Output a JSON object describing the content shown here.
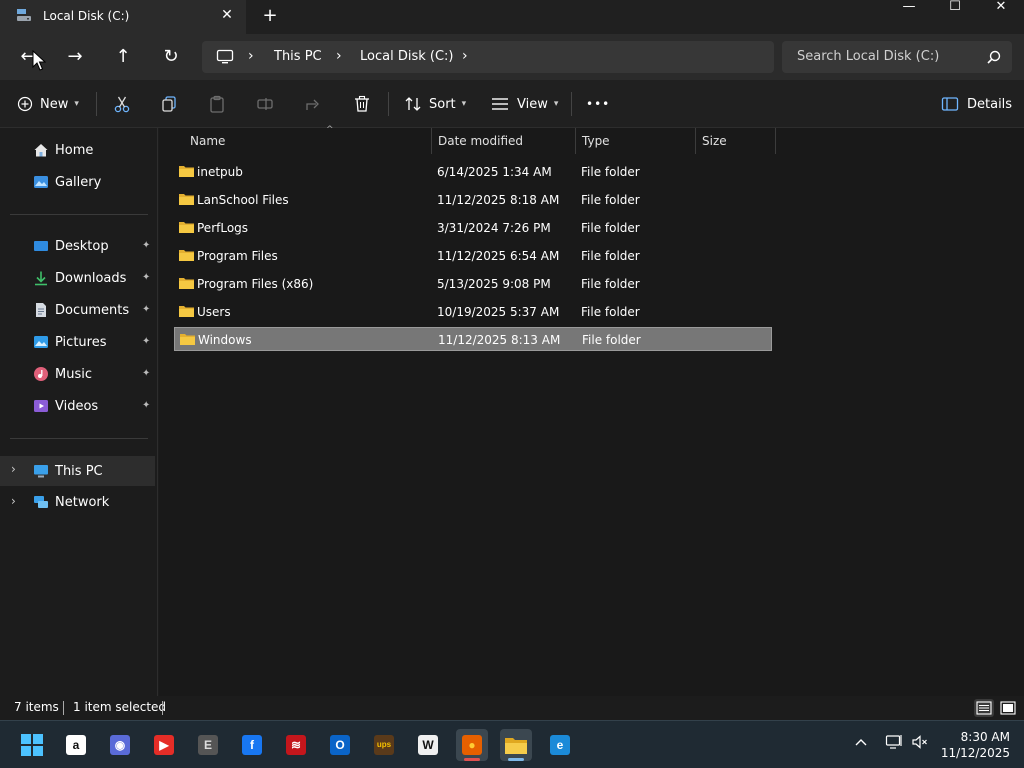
{
  "window": {
    "tab_title": "Local Disk (C:)",
    "tab_close": "✕",
    "new_tab": "+",
    "minimize": "—",
    "maximize": "☐",
    "close": "✕"
  },
  "address": {
    "crumbs": [
      "This PC",
      "Local Disk (C:)"
    ],
    "separator": "›",
    "search_placeholder": "Search Local Disk (C:)"
  },
  "nav_buttons": {
    "back": "←",
    "forward": "→",
    "up": "↑",
    "refresh": "↻"
  },
  "commandbar": {
    "new_label": "New",
    "sort_label": "Sort",
    "view_label": "View",
    "more": "•••",
    "details_label": "Details"
  },
  "navpane": {
    "items": [
      {
        "label": "Home",
        "icon": "home-icon"
      },
      {
        "label": "Gallery",
        "icon": "gallery-icon"
      },
      {
        "label": "Desktop",
        "icon": "desktop-icon",
        "pinned": true
      },
      {
        "label": "Downloads",
        "icon": "downloads-icon",
        "pinned": true
      },
      {
        "label": "Documents",
        "icon": "documents-icon",
        "pinned": true
      },
      {
        "label": "Pictures",
        "icon": "pictures-icon",
        "pinned": true
      },
      {
        "label": "Music",
        "icon": "music-icon",
        "pinned": true
      },
      {
        "label": "Videos",
        "icon": "videos-icon",
        "pinned": true
      },
      {
        "label": "This PC",
        "icon": "computer-icon",
        "expandable": true,
        "selected": true
      },
      {
        "label": "Network",
        "icon": "network-icon",
        "expandable": true
      }
    ],
    "pin_glyph": "📌",
    "chevron": "›"
  },
  "columns": {
    "name": "Name",
    "date": "Date modified",
    "type": "Type",
    "size": "Size"
  },
  "files": [
    {
      "name": "inetpub",
      "date": "6/14/2025 1:34 AM",
      "type": "File folder"
    },
    {
      "name": "LanSchool Files",
      "date": "11/12/2025 8:18 AM",
      "type": "File folder"
    },
    {
      "name": "PerfLogs",
      "date": "3/31/2024 7:26 PM",
      "type": "File folder"
    },
    {
      "name": "Program Files",
      "date": "11/12/2025 6:54 AM",
      "type": "File folder"
    },
    {
      "name": "Program Files (x86)",
      "date": "5/13/2025 9:08 PM",
      "type": "File folder"
    },
    {
      "name": "Users",
      "date": "10/19/2025 5:37 AM",
      "type": "File folder"
    },
    {
      "name": "Windows",
      "date": "11/12/2025 8:13 AM",
      "type": "File folder",
      "selected": true
    }
  ],
  "status": {
    "count": "7 items",
    "selection": "1 item selected"
  },
  "taskbar": {
    "apps": [
      {
        "name": "start",
        "icon": "windows-start-icon"
      },
      {
        "name": "amazon",
        "icon": "amazon-icon",
        "glyph": "a",
        "color": "#ffffff",
        "fg": "#111111"
      },
      {
        "name": "copilot",
        "icon": "copilot-icon",
        "glyph": "◉",
        "color": "#5a6bd8",
        "fg": "#ffffff"
      },
      {
        "name": "youtube",
        "icon": "youtube-icon",
        "glyph": "▶",
        "color": "#e52d27",
        "fg": "#ffffff"
      },
      {
        "name": "app-e",
        "icon": "e-app-icon",
        "glyph": "E",
        "color": "#555555",
        "fg": "#dddddd"
      },
      {
        "name": "facebook",
        "icon": "facebook-icon",
        "glyph": "f",
        "color": "#1877f2",
        "fg": "#ffffff"
      },
      {
        "name": "app-stripes",
        "icon": "stripes-icon",
        "glyph": "≋",
        "color": "#c4161c",
        "fg": "#ffffff"
      },
      {
        "name": "outlook",
        "icon": "outlook-icon",
        "glyph": "O",
        "color": "#0a64c8",
        "fg": "#ffffff"
      },
      {
        "name": "ups",
        "icon": "ups-icon",
        "glyph": "ups",
        "color": "#5a3a1a",
        "fg": "#f5c000"
      },
      {
        "name": "wikipedia",
        "icon": "wikipedia-icon",
        "glyph": "W",
        "color": "#f0f0f0",
        "fg": "#111111"
      },
      {
        "name": "firefox",
        "icon": "firefox-icon",
        "glyph": "●",
        "color": "#e66000",
        "fg": "#ffcc33",
        "active": true
      },
      {
        "name": "file-explorer",
        "icon": "file-explorer-icon",
        "glyph": "▬",
        "color": "#f3c340",
        "fg": "#f3c340",
        "active": true
      },
      {
        "name": "edge",
        "icon": "edge-icon",
        "glyph": "e",
        "color": "#1b8ad8",
        "fg": "#ffffff"
      }
    ],
    "tray_chevron": "^",
    "time": "8:30 AM",
    "date": "11/12/2025"
  },
  "colors": {
    "folder": "#f5c842",
    "selection": "#777777",
    "accent": "#4ca3ff"
  }
}
